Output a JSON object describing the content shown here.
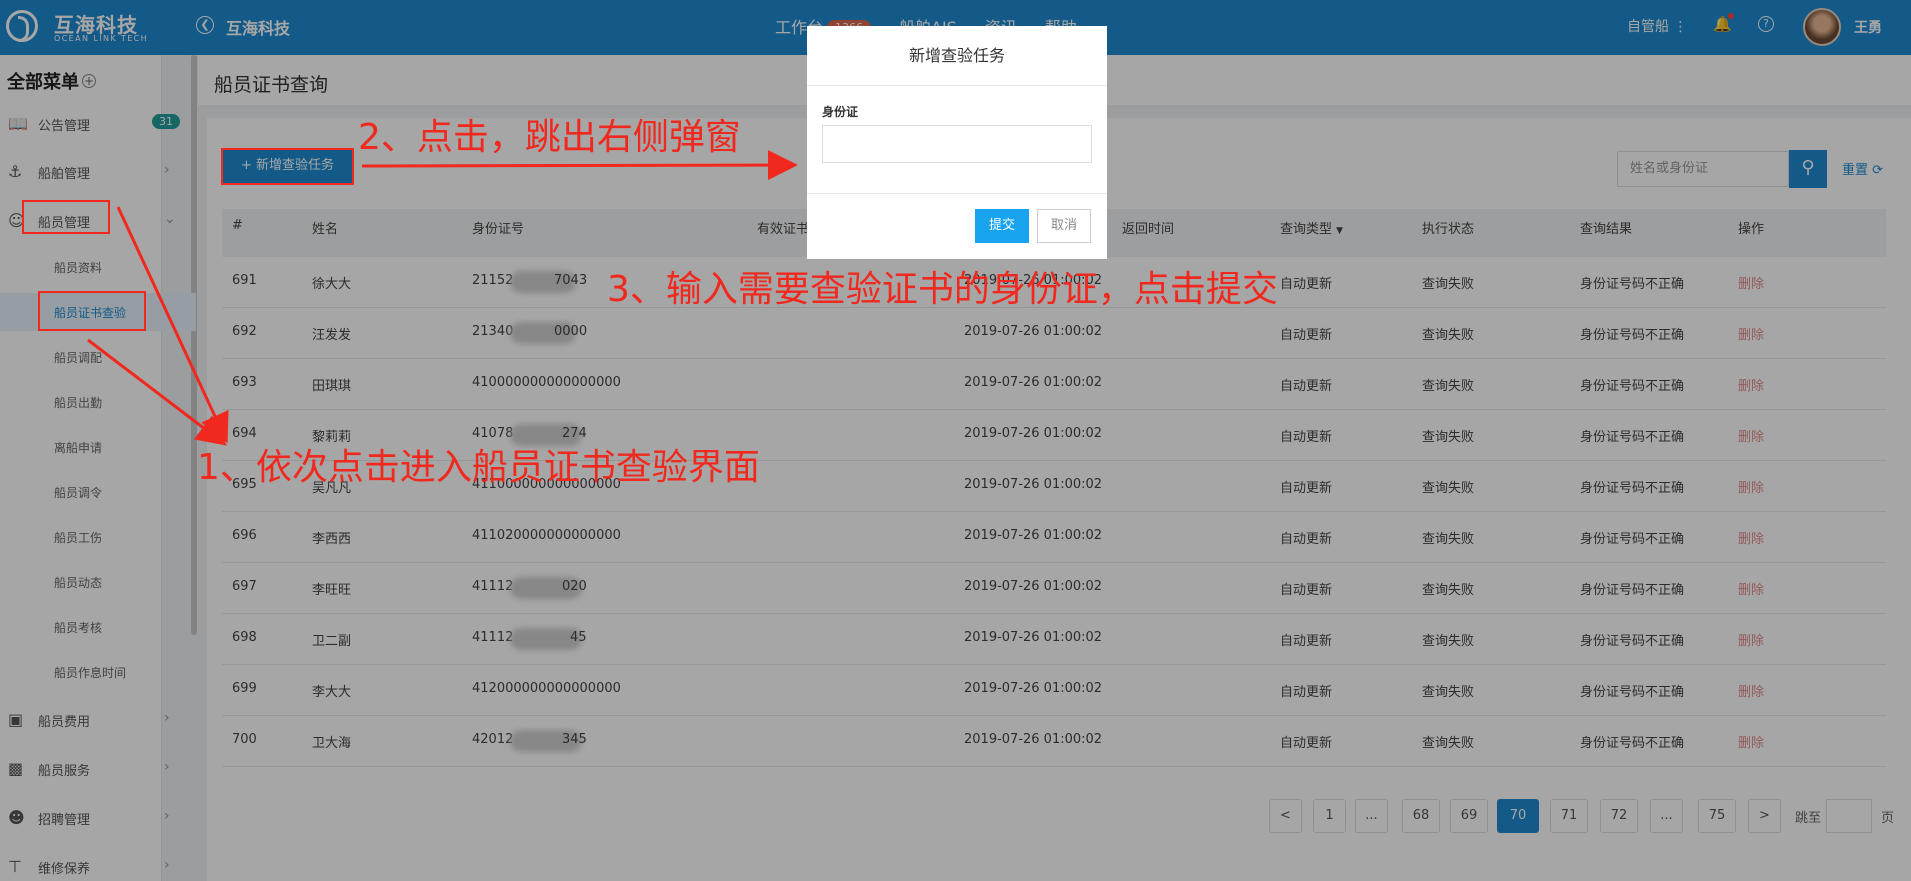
{
  "header": {
    "logo_cn": "互海科技",
    "logo_en": "OCEAN LINK TECH",
    "brand": "互海科技",
    "nav": [
      {
        "label": "工作台",
        "badge": "1366"
      },
      {
        "label": "船舶AIS"
      },
      {
        "label": "资讯"
      },
      {
        "label": "帮助"
      }
    ],
    "user_menu": "自管船 ⋮",
    "username": "王勇"
  },
  "sidebar": {
    "title": "全部菜单",
    "items": [
      {
        "icon": "book-icon",
        "label": "公告管理",
        "count": "31"
      },
      {
        "icon": "anchor-icon",
        "label": "船舶管理"
      },
      {
        "icon": "user-icon",
        "label": "船员管理"
      },
      {
        "icon": "wallet-icon",
        "label": "船员费用"
      },
      {
        "icon": "monitor-icon",
        "label": "船员服务"
      },
      {
        "icon": "user-add-icon",
        "label": "招聘管理"
      },
      {
        "icon": "wrench-icon",
        "label": "维修保养"
      }
    ],
    "sub_items": [
      "船员资料",
      "船员证书查验",
      "船员调配",
      "船员出勤",
      "离船申请",
      "船员调令",
      "船员工伤",
      "船员动态",
      "船员考核",
      "船员作息时间"
    ]
  },
  "page": {
    "title": "船员证书查询",
    "add_button": "新增查验任务",
    "search_placeholder": "姓名或身份证",
    "reset": "重置"
  },
  "table": {
    "headers": [
      "#",
      "姓名",
      "身份证号",
      "有效证书",
      "返回时间",
      "查询类型",
      "执行状态",
      "查询结果",
      "操作"
    ],
    "rows": [
      {
        "id": "691",
        "name": "徐大大",
        "idno": "21152",
        "idno_tail": "7043",
        "time": "2019-07-26 01:00:02",
        "type": "自动更新",
        "status": "查询失败",
        "result": "身份证号码不正确",
        "op": "删除"
      },
      {
        "id": "692",
        "name": "汪发发",
        "idno": "21340",
        "idno_tail": "0000",
        "time": "2019-07-26 01:00:02",
        "type": "自动更新",
        "status": "查询失败",
        "result": "身份证号码不正确",
        "op": "删除"
      },
      {
        "id": "693",
        "name": "田琪琪",
        "idno": "410000000000000000",
        "idno_tail": "",
        "time": "2019-07-26 01:00:02",
        "type": "自动更新",
        "status": "查询失败",
        "result": "身份证号码不正确",
        "op": "删除"
      },
      {
        "id": "694",
        "name": "黎莉莉",
        "idno": "41078",
        "idno_tail": "274",
        "time": "2019-07-26 01:00:02",
        "type": "自动更新",
        "status": "查询失败",
        "result": "身份证号码不正确",
        "op": "删除"
      },
      {
        "id": "695",
        "name": "吴凡凡",
        "idno": "411000000000000000",
        "idno_tail": "",
        "time": "2019-07-26 01:00:02",
        "type": "自动更新",
        "status": "查询失败",
        "result": "身份证号码不正确",
        "op": "删除"
      },
      {
        "id": "696",
        "name": "李西西",
        "idno": "411020000000000000",
        "idno_tail": "",
        "time": "2019-07-26 01:00:02",
        "type": "自动更新",
        "status": "查询失败",
        "result": "身份证号码不正确",
        "op": "删除"
      },
      {
        "id": "697",
        "name": "李旺旺",
        "idno": "41112",
        "idno_tail": "020",
        "time": "2019-07-26 01:00:02",
        "type": "自动更新",
        "status": "查询失败",
        "result": "身份证号码不正确",
        "op": "删除"
      },
      {
        "id": "698",
        "name": "卫二副",
        "idno": "41112",
        "idno_tail": "45",
        "time": "2019-07-26 01:00:02",
        "type": "自动更新",
        "status": "查询失败",
        "result": "身份证号码不正确",
        "op": "删除"
      },
      {
        "id": "699",
        "name": "李大大",
        "idno": "412000000000000000",
        "idno_tail": "",
        "time": "2019-07-26 01:00:02",
        "type": "自动更新",
        "status": "查询失败",
        "result": "身份证号码不正确",
        "op": "删除"
      },
      {
        "id": "700",
        "name": "卫大海",
        "idno": "42012",
        "idno_tail": "345",
        "time": "2019-07-26 01:00:02",
        "type": "自动更新",
        "status": "查询失败",
        "result": "身份证号码不正确",
        "op": "删除"
      }
    ]
  },
  "pagination": {
    "pages": [
      "<",
      "1",
      "...",
      "68",
      "69",
      "70",
      "71",
      "72",
      "...",
      "75",
      ">"
    ],
    "current": "70",
    "jump_label": "跳至",
    "jump_suffix": "页"
  },
  "modal": {
    "title": "新增查验任务",
    "field_label": "身份证",
    "submit": "提交",
    "cancel": "取消"
  },
  "annotations": {
    "step1": "1、依次点击进入船员证书查验界面",
    "step2": "2、点击，跳出右侧弹窗",
    "step3": "3、输入需要查验证书的身份证，点击提交"
  },
  "colors": {
    "primary": "#1e8bd1",
    "annotation": "#f0281e",
    "submit": "#17a3ee"
  }
}
